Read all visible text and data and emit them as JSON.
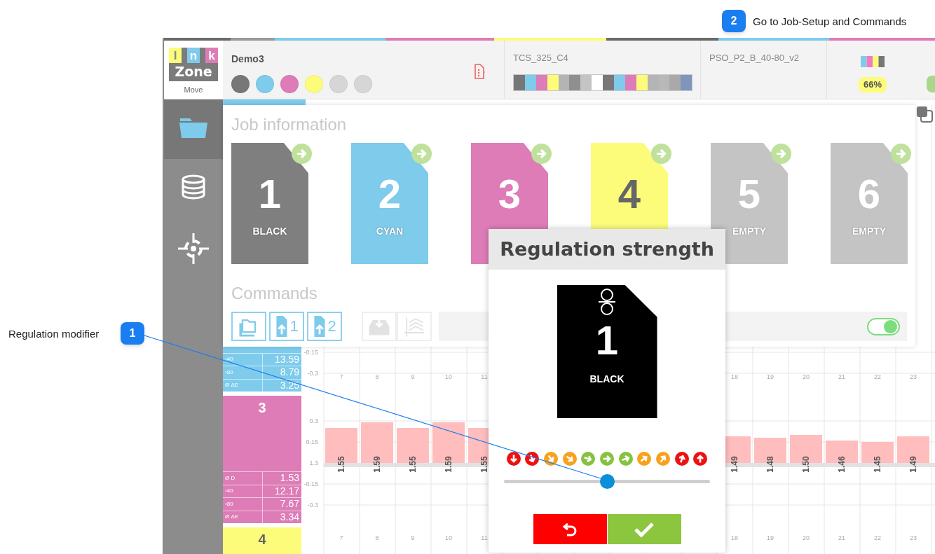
{
  "callouts": [
    {
      "number": "2",
      "text": "Go to Job-Setup and Commands"
    },
    {
      "number": "1",
      "text": "Regulation modifier"
    }
  ],
  "ink_stripes": [
    {
      "color": "#6b6b6b"
    },
    {
      "color": "#9a9a9a"
    },
    {
      "color": "#7ecbeb"
    },
    {
      "color": "#dd7cb7"
    },
    {
      "color": "#fcfc7a"
    },
    {
      "color": "#6b6b6b"
    },
    {
      "color": "#7ecbeb"
    },
    {
      "color": "#dd7cb7"
    }
  ],
  "header": {
    "logo": {
      "letters": [
        "I",
        "n",
        "k"
      ],
      "word": "Zone",
      "caption": "Move"
    },
    "job": {
      "name": "Demo3",
      "inks": [
        {
          "color": "#777777"
        },
        {
          "color": "#7ecbeb"
        },
        {
          "color": "#dd7cb7"
        },
        {
          "color": "#fcfc7a"
        },
        {
          "color": "#d6d6d6"
        },
        {
          "color": "#d6d6d6"
        }
      ]
    },
    "strips": [
      {
        "name": "TCS_325_C4",
        "swatches": [
          {
            "color": "#777777"
          },
          {
            "color": "#7ecbeb"
          },
          {
            "color": "#dd7cb7"
          },
          {
            "color": "#fcfc7a"
          },
          {
            "color": "#b4b4b4"
          },
          {
            "color": "#8f8f8f"
          },
          {
            "color": "#c4c4c4"
          },
          {
            "color": "#ffffff"
          },
          {
            "color": "#787878"
          },
          {
            "color": "#7ecbeb"
          },
          {
            "color": "#dd7cb7"
          },
          {
            "color": "#fcfc7a"
          },
          {
            "color": "#b4b4b4"
          },
          {
            "color": "#b8b8b8"
          },
          {
            "color": "#a9a9a9"
          },
          {
            "color": "#7f95bc"
          }
        ]
      },
      {
        "name": "PSO_P2_B_40-80_v2"
      }
    ],
    "coverage": "66%"
  },
  "sidebar": {
    "items": [
      {
        "kind": "folder",
        "selected": true
      },
      {
        "kind": "database",
        "selected": false
      },
      {
        "kind": "target",
        "selected": false
      }
    ]
  },
  "ink_zones": [
    {
      "color": "#7ecbeb",
      "stats": [
        {
          "label": "▫40",
          "value": "13.59"
        },
        {
          "label": "▫80",
          "value": "8.79"
        },
        {
          "label": "Ø ΔE",
          "value": "3.25"
        }
      ]
    },
    {
      "color": "#dd7cb7",
      "number": "3",
      "stats": [
        {
          "label": "Ø D",
          "value": "1.53"
        },
        {
          "label": "▫40",
          "value": "12.17"
        },
        {
          "label": "▫80",
          "value": "7.67"
        },
        {
          "label": "Ø ΔE",
          "value": "3.34"
        }
      ]
    },
    {
      "color": "#fcfc7a",
      "number": "4"
    }
  ],
  "zone_chart": {
    "upper_strip_ticks": [
      "-0.15",
      "-0.3"
    ],
    "baseline_label": "1.3",
    "bar_labels": [
      "1.55",
      "1.59",
      "1.55",
      "1.59",
      "1.55",
      "1.49",
      "1.48",
      "1.50",
      "1.46",
      "1.45",
      "1.49"
    ],
    "lower_column_labels": [
      "7",
      "8",
      "9",
      "10",
      "11",
      "18",
      "19",
      "20",
      "21",
      "22",
      "23"
    ],
    "chart_data": {
      "type": "bar",
      "categories": [
        "7",
        "8",
        "9",
        "10",
        "11",
        "18",
        "19",
        "20",
        "21",
        "22",
        "23"
      ],
      "values": [
        0.25,
        0.29,
        0.25,
        0.29,
        0.25,
        0.19,
        0.18,
        0.2,
        0.16,
        0.15,
        0.19
      ],
      "yticks": [
        0.3,
        0.15,
        -0.15,
        -0.3
      ],
      "ylim": [
        -0.65,
        2.555
      ],
      "grid": true,
      "bands": [
        {
          "axis": "y",
          "from": -0.03,
          "to": 0
        }
      ]
    }
  },
  "job_panel": {
    "title": "Job information",
    "units": [
      {
        "number": "1",
        "label": "BLACK",
        "color": "#7f7f7f"
      },
      {
        "number": "2",
        "label": "CYAN",
        "color": "#7ecbeb"
      },
      {
        "number": "3",
        "color": "#dd7cb7"
      },
      {
        "number": "4",
        "color": "#fcfc7a"
      },
      {
        "number": "5",
        "label": "EMPTY",
        "color": "#c4c4c4"
      },
      {
        "number": "6",
        "label": "EMPTY",
        "color": "#c4c4c4"
      }
    ],
    "commands_title": "Commands",
    "commands": [
      {
        "kind": "folders",
        "enabled": true
      },
      {
        "kind": "upload",
        "label": "1",
        "enabled": true
      },
      {
        "kind": "upload",
        "label": "2",
        "enabled": true
      },
      {
        "kind": "tray",
        "enabled": false
      },
      {
        "kind": "curves",
        "enabled": false
      }
    ],
    "auto_toggle": {
      "on": true
    }
  },
  "dialog": {
    "title": "Regulation strength",
    "unit": {
      "number": "1",
      "label": "BLACK"
    },
    "steps": [
      {
        "color": "#ee1111"
      },
      {
        "color": "#ee1111"
      },
      {
        "color": "#f7a21b"
      },
      {
        "color": "#f7a21b"
      },
      {
        "color": "#86c240"
      },
      {
        "color": "#86c240"
      },
      {
        "color": "#86c240"
      },
      {
        "color": "#f7a21b"
      },
      {
        "color": "#f7a21b"
      },
      {
        "color": "#ee1111"
      },
      {
        "color": "#ee1111"
      }
    ],
    "slider": {
      "level": 0.5
    },
    "buttons": [
      {
        "kind": "undo"
      },
      {
        "kind": "confirm"
      }
    ]
  }
}
